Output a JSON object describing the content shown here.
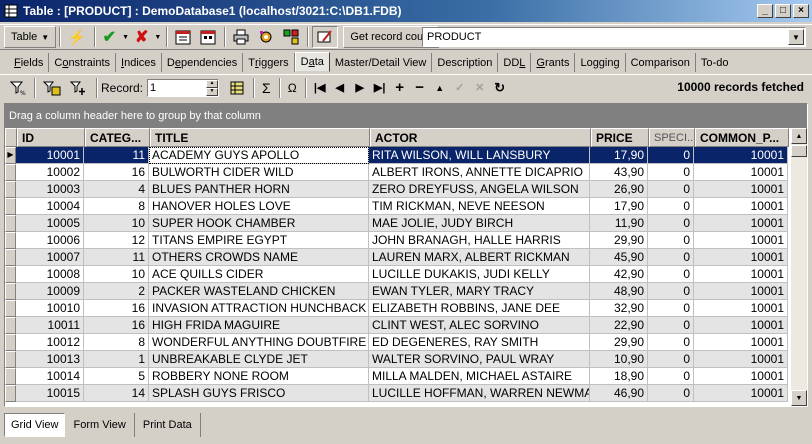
{
  "window": {
    "title": "Table : [PRODUCT] : DemoDatabase1 (localhost/3021:C:\\DB1.FDB)",
    "buttons": [
      "_",
      "□",
      "×"
    ]
  },
  "toolbar": {
    "table_menu": "Table",
    "get_record_count": "Get record count",
    "table_name": "PRODUCT"
  },
  "tabs": [
    {
      "pre": "",
      "u": "F",
      "post": "ields"
    },
    {
      "pre": "C",
      "u": "o",
      "post": "nstraints"
    },
    {
      "pre": "",
      "u": "I",
      "post": "ndices"
    },
    {
      "pre": "D",
      "u": "e",
      "post": "pendencies"
    },
    {
      "pre": "T",
      "u": "r",
      "post": "iggers"
    },
    {
      "pre": "D",
      "u": "a",
      "post": "ta"
    },
    {
      "pre": "Master/Detail View",
      "u": "",
      "post": ""
    },
    {
      "pre": "Description",
      "u": "",
      "post": ""
    },
    {
      "pre": "DD",
      "u": "L",
      "post": ""
    },
    {
      "pre": "",
      "u": "G",
      "post": "rants"
    },
    {
      "pre": "Logging",
      "u": "",
      "post": ""
    },
    {
      "pre": "Comparison",
      "u": "",
      "post": ""
    },
    {
      "pre": "To-do",
      "u": "",
      "post": ""
    }
  ],
  "navbar": {
    "record_label": "Record:",
    "record_value": "1",
    "sigma": "Σ",
    "omega": "Ω",
    "records_fetched": "10000 records fetched"
  },
  "grid": {
    "group_hint": "Drag a column header here to group by that column",
    "columns": [
      "ID",
      "CATEG...",
      "TITLE",
      "ACTOR",
      "PRICE",
      "SPECI...",
      "COMMON_P..."
    ],
    "rows": [
      [
        "10001",
        "11",
        "ACADEMY GUYS APOLLO",
        "RITA WILSON,  WILL LANSBURY",
        "17,90",
        "0",
        "10001"
      ],
      [
        "10002",
        "16",
        "BULWORTH CIDER WILD",
        "ALBERT IRONS,  ANNETTE DICAPRIO",
        "43,90",
        "0",
        "10001"
      ],
      [
        "10003",
        "4",
        "BLUES PANTHER HORN",
        "ZERO DREYFUSS,  ANGELA WILSON",
        "26,90",
        "0",
        "10001"
      ],
      [
        "10004",
        "8",
        "HANOVER HOLES LOVE",
        "TIM RICKMAN,  NEVE NEESON",
        "17,90",
        "0",
        "10001"
      ],
      [
        "10005",
        "10",
        "SUPER HOOK CHAMBER",
        "MAE JOLIE,  JUDY BIRCH",
        "11,90",
        "0",
        "10001"
      ],
      [
        "10006",
        "12",
        "TITANS EMPIRE EGYPT",
        "JOHN BRANAGH,  HALLE HARRIS",
        "29,90",
        "0",
        "10001"
      ],
      [
        "10007",
        "11",
        "OTHERS CROWDS NAME",
        "LAUREN MARX,  ALBERT RICKMAN",
        "45,90",
        "0",
        "10001"
      ],
      [
        "10008",
        "10",
        "ACE QUILLS CIDER",
        "LUCILLE DUKAKIS,  JUDI KELLY",
        "42,90",
        "0",
        "10001"
      ],
      [
        "10009",
        "2",
        "PACKER WASTELAND CHICKEN",
        "EWAN TYLER,  MARY TRACY",
        "48,90",
        "0",
        "10001"
      ],
      [
        "10010",
        "16",
        "INVASION ATTRACTION HUNCHBACK",
        "ELIZABETH ROBBINS,  JANE DEE",
        "32,90",
        "0",
        "10001"
      ],
      [
        "10011",
        "16",
        "HIGH FRIDA MAGUIRE",
        "CLINT WEST,  ALEC SORVINO",
        "22,90",
        "0",
        "10001"
      ],
      [
        "10012",
        "8",
        "WONDERFUL ANYTHING DOUBTFIRE",
        "ED DEGENERES,  RAY SMITH",
        "29,90",
        "0",
        "10001"
      ],
      [
        "10013",
        "1",
        "UNBREAKABLE CLYDE JET",
        "WALTER SORVINO,  PAUL WRAY",
        "10,90",
        "0",
        "10001"
      ],
      [
        "10014",
        "5",
        "ROBBERY NONE ROOM",
        "MILLA MALDEN,  MICHAEL ASTAIRE",
        "18,90",
        "0",
        "10001"
      ],
      [
        "10015",
        "14",
        "SPLASH GUYS FRISCO",
        "LUCILLE HOFFMAN,  WARREN NEWMAN",
        "46,90",
        "0",
        "10001"
      ]
    ]
  },
  "view_tabs": [
    "Grid View",
    "Form View",
    "Print Data"
  ],
  "colors": {
    "title_bar": "#0a246a",
    "selection": "#0a246a",
    "face": "#d4d0c8"
  }
}
